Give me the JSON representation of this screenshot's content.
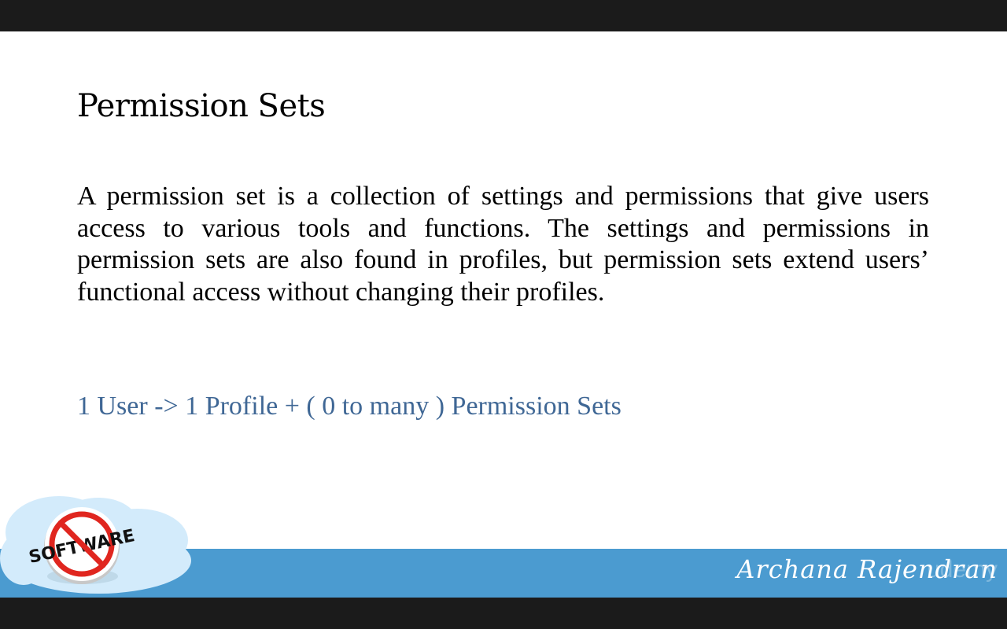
{
  "slide": {
    "title": "Permission Sets",
    "body": "A permission set is a collection of settings and permissions that give users access to various tools and functions. The settings and permissions in permission sets are also found in profiles, but permission sets extend users’ functional access without changing their profiles.",
    "formula": "1 User -> 1 Profile + ( 0 to many ) Permission Sets"
  },
  "footer": {
    "logo_text": "SOFTWARE",
    "signature": "Archana Rajendran",
    "watermark": "udemy"
  },
  "colors": {
    "frame": "#1b1b1b",
    "slide_bg": "#ffffff",
    "band": "#4b9bd0",
    "formula": "#3f6795",
    "cloud": "#d3ebfb",
    "no_sign": "#e0261f"
  },
  "icons": [
    "cloud-icon",
    "no-software-icon"
  ]
}
